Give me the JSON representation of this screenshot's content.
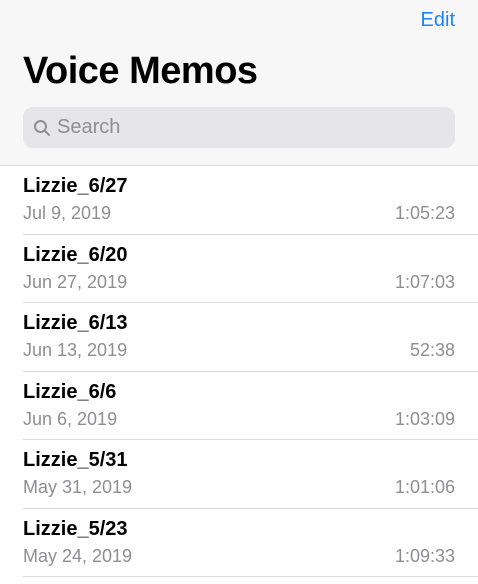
{
  "header": {
    "edit_label": "Edit",
    "title": "Voice Memos"
  },
  "search": {
    "icon": "search-icon",
    "placeholder": "Search",
    "value": ""
  },
  "memos": [
    {
      "title": "Lizzie_6/27",
      "date": "Jul 9, 2019",
      "duration": "1:05:23"
    },
    {
      "title": "Lizzie_6/20",
      "date": "Jun 27, 2019",
      "duration": "1:07:03"
    },
    {
      "title": "Lizzie_6/13",
      "date": "Jun 13, 2019",
      "duration": "52:38"
    },
    {
      "title": "Lizzie_6/6",
      "date": "Jun 6, 2019",
      "duration": "1:03:09"
    },
    {
      "title": "Lizzie_5/31",
      "date": "May 31, 2019",
      "duration": "1:01:06"
    },
    {
      "title": "Lizzie_5/23",
      "date": "May 24, 2019",
      "duration": "1:09:33"
    }
  ],
  "colors": {
    "accent": "#1a84ff",
    "secondary_text": "#8e8e93",
    "search_background": "#e5e5ea",
    "header_background": "#f7f7f8"
  }
}
